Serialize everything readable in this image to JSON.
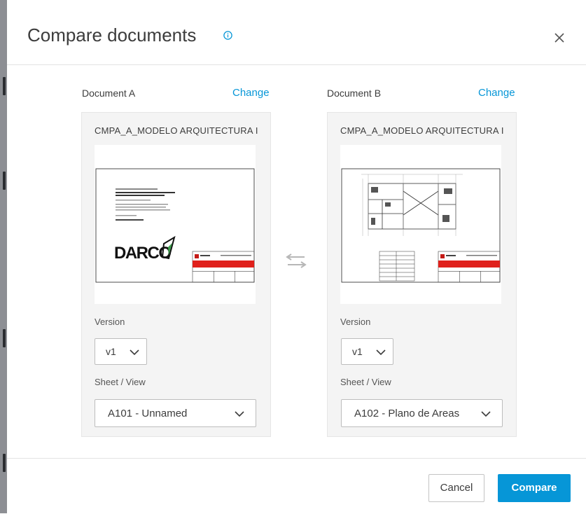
{
  "dialog": {
    "title": "Compare documents",
    "info_icon": "info-icon",
    "close_icon": "close-icon"
  },
  "document_a": {
    "heading": "Document A",
    "change_label": "Change",
    "file_name": "CMPA_A_MODELO ARQUITECTURA I",
    "version_label": "Version",
    "version_value": "v1",
    "sheet_label": "Sheet / View",
    "sheet_value": "A101 - Unnamed"
  },
  "document_b": {
    "heading": "Document B",
    "change_label": "Change",
    "file_name": "CMPA_A_MODELO ARQUITECTURA I",
    "version_label": "Version",
    "version_value": "v1",
    "sheet_label": "Sheet / View",
    "sheet_value": "A102 - Plano de Areas"
  },
  "swap_icon": "swap-arrows-icon",
  "footer": {
    "cancel_label": "Cancel",
    "compare_label": "Compare"
  },
  "colors": {
    "accent": "#0696d7",
    "title_block_red": "#e0201b"
  }
}
